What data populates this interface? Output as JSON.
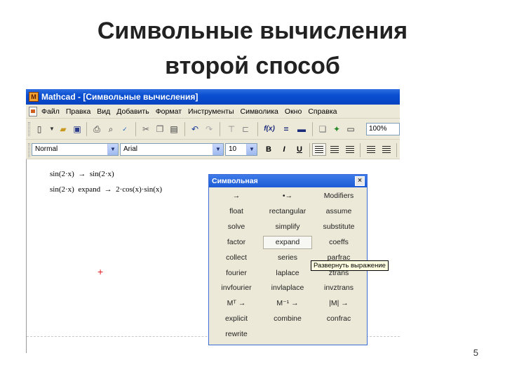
{
  "slide": {
    "title_line1": "Символьные вычисления",
    "title_line2": "второй способ",
    "page_number": "5"
  },
  "window": {
    "title": "Mathcad - [Символьные вычисления]",
    "app_icon": "mathcad-logo-icon"
  },
  "menu": {
    "items": [
      "Файл",
      "Правка",
      "Вид",
      "Добавить",
      "Формат",
      "Инструменты",
      "Символика",
      "Окно",
      "Справка"
    ]
  },
  "toolbar": {
    "zoom": "100%",
    "icons": [
      "new-icon",
      "open-icon",
      "save-icon",
      "print-icon",
      "print-preview-icon",
      "spellcheck-icon",
      "cut-icon",
      "copy-icon",
      "paste-icon",
      "undo-icon",
      "redo-icon",
      "align-icon",
      "insert-function-icon",
      "insert-unit-icon",
      "component-icon",
      "resources-icon",
      "calculate-icon"
    ]
  },
  "format_bar": {
    "style": "Normal",
    "font": "Arial",
    "size": "10",
    "bold": "B",
    "italic": "I",
    "underline": "U"
  },
  "worksheet": {
    "expr1": "sin(2·x)  →  sin(2·x)",
    "expr2": "sin(2·x)  expand  →  2·cos(x)·sin(x)",
    "cursor": "+"
  },
  "palette": {
    "title": "Символьная",
    "close": "×",
    "rows": [
      [
        "→",
        "•→",
        "Modifiers"
      ],
      [
        "float",
        "rectangular",
        "assume"
      ],
      [
        "solve",
        "simplify",
        "substitute"
      ],
      [
        "factor",
        "expand",
        "coeffs"
      ],
      [
        "collect",
        "series",
        "parfrac"
      ],
      [
        "fourier",
        "laplace",
        "ztrans"
      ],
      [
        "invfourier",
        "invlaplace",
        "invztrans"
      ],
      [
        "Mᵀ →",
        "M⁻¹ →",
        "|M| →"
      ],
      [
        "explicit",
        "combine",
        "confrac"
      ],
      [
        "rewrite",
        "",
        ""
      ]
    ],
    "active": "expand",
    "tooltip": "Развернуть выражение"
  }
}
